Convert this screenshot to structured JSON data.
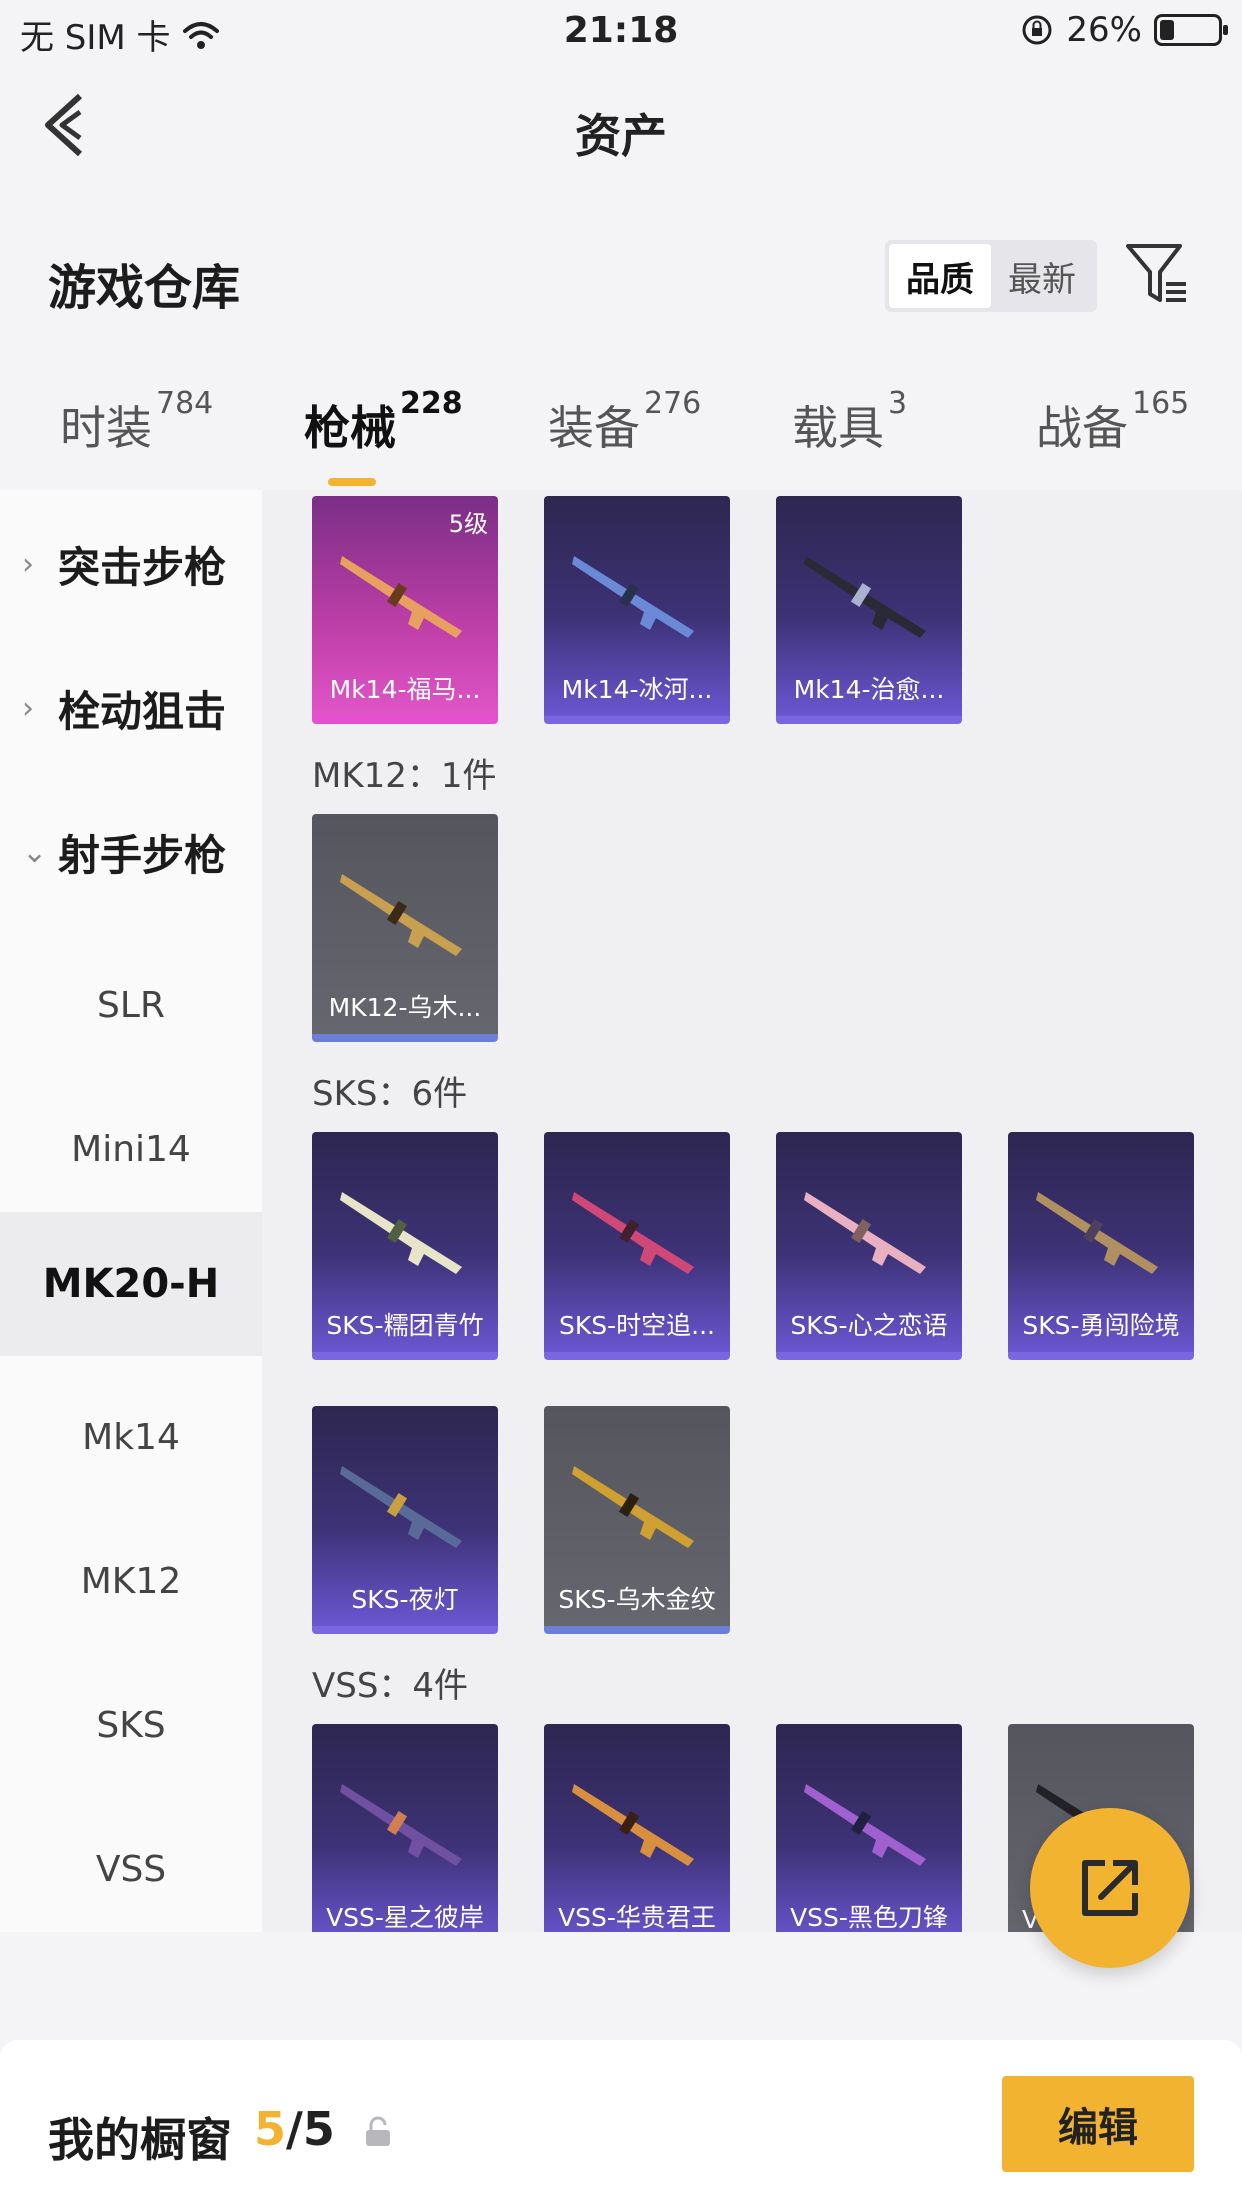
{
  "status_bar": {
    "carrier": "无 SIM 卡",
    "time": "21:18",
    "battery": "26%"
  },
  "nav": {
    "title": "资产"
  },
  "section": {
    "title": "游戏仓库",
    "sort_options": [
      "品质",
      "最新"
    ],
    "sort_active": "品质"
  },
  "categories": [
    {
      "label": "时装",
      "count": "784"
    },
    {
      "label": "枪械",
      "count": "228"
    },
    {
      "label": "装备",
      "count": "276"
    },
    {
      "label": "载具",
      "count": "3"
    },
    {
      "label": "战备",
      "count": "165"
    }
  ],
  "sidebar": {
    "groups": [
      "突击步枪",
      "栓动狙击",
      "射手步枪"
    ],
    "items": [
      "SLR",
      "Mini14",
      "MK20-H",
      "Mk14",
      "MK12",
      "SKS",
      "VSS"
    ],
    "active_item": "MK20-H"
  },
  "content": {
    "row_mk14": [
      {
        "name": "Mk14-福马...",
        "level": "5级",
        "rarity": "pink"
      },
      {
        "name": "Mk14-冰河...",
        "rarity": "purple"
      },
      {
        "name": "Mk14-治愈...",
        "rarity": "purple"
      }
    ],
    "mk12_label": "MK12：1件",
    "mk12": [
      {
        "name": "MK12-乌木...",
        "rarity": "grey"
      }
    ],
    "sks_label": "SKS：6件",
    "sks": [
      {
        "name": "SKS-糯团青竹",
        "rarity": "purple"
      },
      {
        "name": "SKS-时空追...",
        "rarity": "purple"
      },
      {
        "name": "SKS-心之恋语",
        "rarity": "purple"
      },
      {
        "name": "SKS-勇闯险境",
        "rarity": "purple"
      },
      {
        "name": "SKS-夜灯",
        "rarity": "purple"
      },
      {
        "name": "SKS-乌木金纹",
        "rarity": "grey"
      }
    ],
    "vss_label": "VSS：4件",
    "vss": [
      {
        "name": "VSS-星之彼岸",
        "rarity": "purple"
      },
      {
        "name": "VSS-华贵君王",
        "rarity": "purple"
      },
      {
        "name": "VSS-黑色刀锋",
        "rarity": "purple"
      },
      {
        "name": "V",
        "rarity": "grey"
      }
    ]
  },
  "bottom": {
    "title": "我的橱窗",
    "count_current": "5",
    "count_sep": "/",
    "count_total": "5",
    "edit_label": "编辑"
  },
  "colors": {
    "accent": "#f2b430",
    "purple_card": "#3d3276",
    "pink_card": "#bf3fa8",
    "grey_card": "#5e5e66"
  }
}
